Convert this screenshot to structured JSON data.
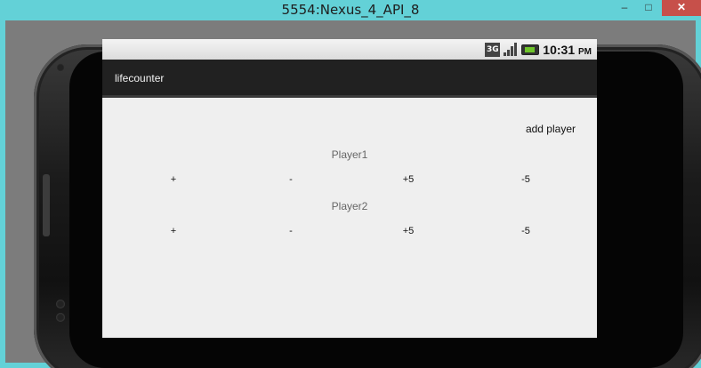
{
  "window": {
    "title": "5554:Nexus_4_API_8",
    "minimize_glyph": "–",
    "maximize_glyph": "□",
    "close_glyph": "✕"
  },
  "status_bar": {
    "network": "3G",
    "time": "10:31",
    "ampm": "PM",
    "icons": [
      "3g-icon",
      "signal-icon",
      "battery-icon"
    ]
  },
  "app": {
    "title": "lifecounter",
    "add_player_label": "add player"
  },
  "players": [
    {
      "name": "Player1",
      "buttons": [
        "+",
        "-",
        "+5",
        "-5"
      ]
    },
    {
      "name": "Player2",
      "buttons": [
        "+",
        "-",
        "+5",
        "-5"
      ]
    }
  ],
  "colors": {
    "titlebar": "#63d1d7",
    "close_button": "#c7504a",
    "action_bar": "#212121",
    "screen_bg": "#efefef",
    "battery_fill": "#6ec42a"
  }
}
